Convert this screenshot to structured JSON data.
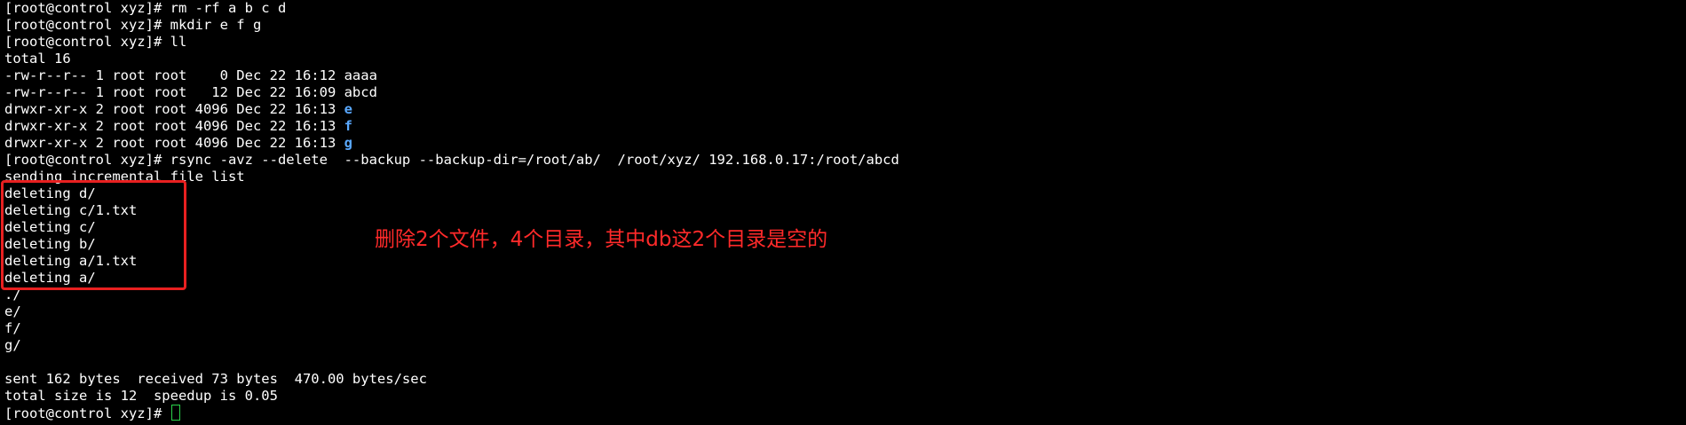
{
  "terminal": {
    "lines": [
      {
        "text": "[root@control xyz]# rm -rf a b c d"
      },
      {
        "text": "[root@control xyz]# mkdir e f g"
      },
      {
        "text": "[root@control xyz]# ll"
      },
      {
        "text": "total 16"
      },
      {
        "text": "-rw-r--r-- 1 root root    0 Dec 22 16:12 aaaa"
      },
      {
        "text": "-rw-r--r-- 1 root root   12 Dec 22 16:09 abcd"
      },
      {
        "text": "drwxr-xr-x 2 root root 4096 Dec 22 16:13 ",
        "dir": "e"
      },
      {
        "text": "drwxr-xr-x 2 root root 4096 Dec 22 16:13 ",
        "dir": "f"
      },
      {
        "text": "drwxr-xr-x 2 root root 4096 Dec 22 16:13 ",
        "dir": "g"
      },
      {
        "text": "[root@control xyz]# rsync -avz --delete  --backup --backup-dir=/root/ab/  /root/xyz/ 192.168.0.17:/root/abcd"
      },
      {
        "text": "sending incremental file list"
      },
      {
        "text": "deleting d/"
      },
      {
        "text": "deleting c/1.txt"
      },
      {
        "text": "deleting c/"
      },
      {
        "text": "deleting b/"
      },
      {
        "text": "deleting a/1.txt"
      },
      {
        "text": "deleting a/"
      },
      {
        "text": "./"
      },
      {
        "text": "e/"
      },
      {
        "text": "f/"
      },
      {
        "text": "g/"
      },
      {
        "text": ""
      },
      {
        "text": "sent 162 bytes  received 73 bytes  470.00 bytes/sec"
      },
      {
        "text": "total size is 12  speedup is 0.05"
      },
      {
        "text": "[root@control xyz]# ",
        "cursor": true
      }
    ]
  },
  "annotation": {
    "text": "删除2个文件，4个目录，其中db这2个目录是空的"
  },
  "colors": {
    "background": "#000000",
    "foreground": "#ffffff",
    "directory": "#5aa9ff",
    "cursor": "#2bd14a",
    "highlight": "#e82020",
    "annotation": "#ff2a2a"
  }
}
